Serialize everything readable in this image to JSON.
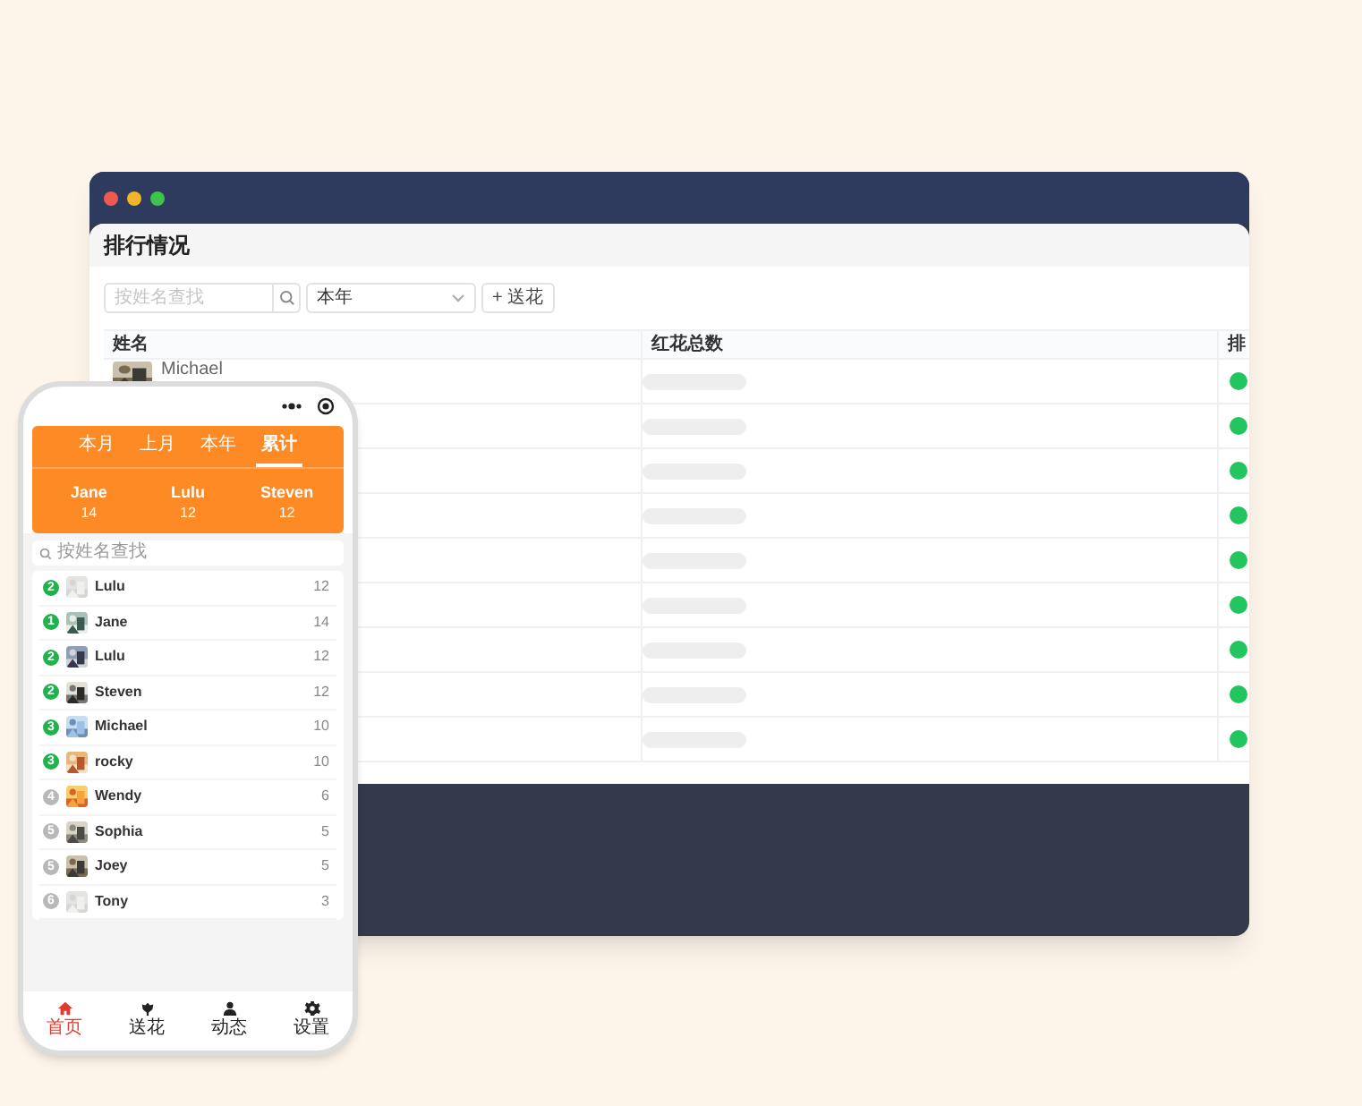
{
  "desktop_window": {
    "title": "排行情况",
    "toolbar": {
      "search": {
        "placeholder": "按姓名查找"
      },
      "period_select": {
        "value": "本年"
      },
      "gift_button": {
        "icon": "+",
        "label": "送花"
      }
    },
    "table": {
      "columns": [
        "姓名",
        "红花总数",
        "排"
      ],
      "rows": [
        {
          "kind": "named",
          "name": "Michael"
        },
        {
          "kind": "hidden"
        },
        {
          "kind": "hidden"
        },
        {
          "kind": "hidden"
        },
        {
          "kind": "hidden"
        },
        {
          "kind": "hidden"
        },
        {
          "kind": "hidden"
        },
        {
          "kind": "hidden"
        },
        {
          "kind": "hidden"
        }
      ]
    }
  },
  "phone": {
    "tabs": [
      {
        "label": "本月",
        "selected": false
      },
      {
        "label": "上月",
        "selected": false
      },
      {
        "label": "本年",
        "selected": false
      },
      {
        "label": "累计",
        "selected": true
      }
    ],
    "podium": [
      {
        "name": "Jane",
        "count": "14"
      },
      {
        "name": "Lulu",
        "count": "12"
      },
      {
        "name": "Steven",
        "count": "12"
      }
    ],
    "search": {
      "placeholder": "按姓名查找"
    },
    "ranking": [
      {
        "rank": "2",
        "color": "#22b14c",
        "name": "Lulu",
        "count": "12"
      },
      {
        "rank": "1",
        "color": "#22b14c",
        "name": "Jane",
        "count": "14"
      },
      {
        "rank": "2",
        "color": "#22b14c",
        "name": "Lulu",
        "count": "12"
      },
      {
        "rank": "2",
        "color": "#22b14c",
        "name": "Steven",
        "count": "12"
      },
      {
        "rank": "3",
        "color": "#22b14c",
        "name": "Michael",
        "count": "10"
      },
      {
        "rank": "3",
        "color": "#22b14c",
        "name": "rocky",
        "count": "10"
      },
      {
        "rank": "4",
        "color": "#b8b8b8",
        "name": "Wendy",
        "count": "6"
      },
      {
        "rank": "5",
        "color": "#b8b8b8",
        "name": "Sophia",
        "count": "5"
      },
      {
        "rank": "5",
        "color": "#b8b8b8",
        "name": "Joey",
        "count": "5"
      },
      {
        "rank": "6",
        "color": "#b8b8b8",
        "name": "Tony",
        "count": "3"
      }
    ],
    "bottom_nav": [
      {
        "label": "首页",
        "kind": "home",
        "selected": true
      },
      {
        "label": "送花",
        "kind": "flower",
        "selected": false
      },
      {
        "label": "动态",
        "kind": "person",
        "selected": false
      },
      {
        "label": "设置",
        "kind": "gear",
        "selected": false
      }
    ]
  }
}
